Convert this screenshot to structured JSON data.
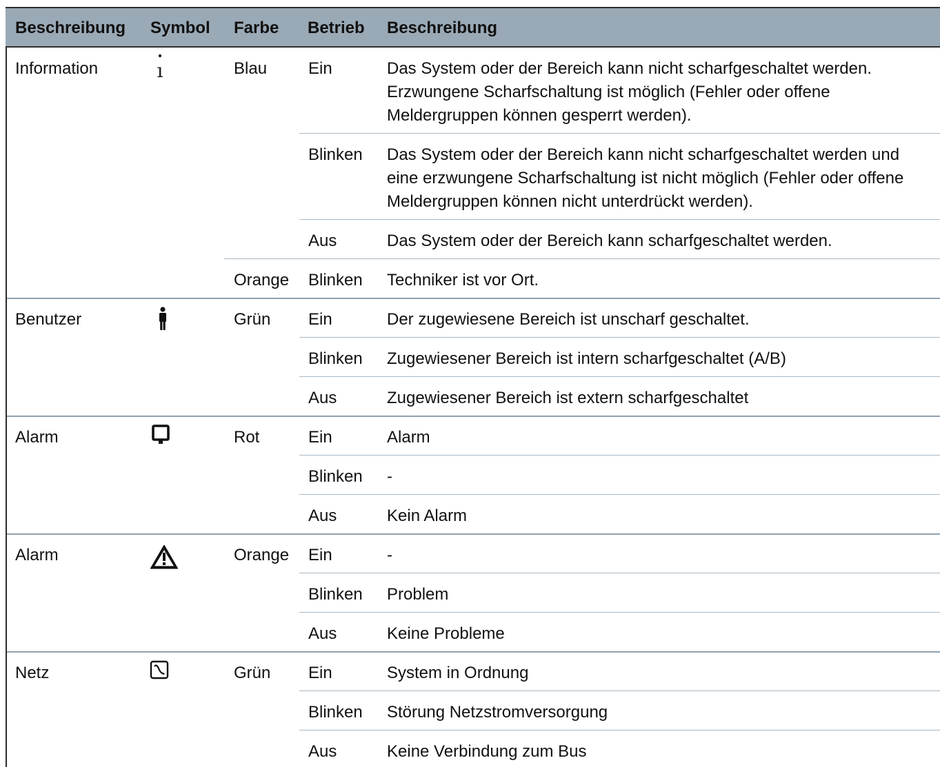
{
  "header": {
    "col1": "Beschreibung",
    "col2": "Symbol",
    "col3": "Farbe",
    "col4": "Betrieb",
    "col5": "Beschreibung"
  },
  "groups": [
    {
      "description": "Information",
      "icon": "info-i-icon",
      "rows": [
        {
          "color": "Blau",
          "operation": "Ein",
          "text": "Das System oder der Bereich kann nicht scharfgeschaltet werden. Erzwungene Scharfschaltung ist möglich (Fehler oder offene Meldergruppen können gesperrt werden)."
        },
        {
          "color": "",
          "operation": "Blinken",
          "text": "Das System oder der Bereich kann nicht scharfgeschaltet werden und eine erzwungene Scharfschaltung ist nicht möglich (Fehler oder offene Meldergruppen können nicht unterdrückt werden)."
        },
        {
          "color": "",
          "operation": "Aus",
          "text": "Das System oder der Bereich kann scharfgeschaltet werden."
        },
        {
          "color": "Orange",
          "operation": "Blinken",
          "text": "Techniker ist vor Ort."
        }
      ]
    },
    {
      "description": "Benutzer",
      "icon": "person-icon",
      "rows": [
        {
          "color": "Grün",
          "operation": "Ein",
          "text": "Der zugewiesene Bereich ist unscharf geschaltet."
        },
        {
          "color": "",
          "operation": "Blinken",
          "text": "Zugewiesener Bereich ist intern scharfgeschaltet (A/B)"
        },
        {
          "color": "",
          "operation": "Aus",
          "text": "Zugewiesener Bereich ist extern scharfgeschaltet"
        }
      ]
    },
    {
      "description": "Alarm",
      "icon": "bell-icon",
      "rows": [
        {
          "color": "Rot",
          "operation": "Ein",
          "text": "Alarm"
        },
        {
          "color": "",
          "operation": "Blinken",
          "text": "-"
        },
        {
          "color": "",
          "operation": "Aus",
          "text": "Kein Alarm"
        }
      ]
    },
    {
      "description": "Alarm",
      "icon": "warning-triangle-icon",
      "rows": [
        {
          "color": "Orange",
          "operation": "Ein",
          "text": "-"
        },
        {
          "color": "",
          "operation": "Blinken",
          "text": "Problem"
        },
        {
          "color": "",
          "operation": "Aus",
          "text": "Keine Probleme"
        }
      ]
    },
    {
      "description": "Netz",
      "icon": "ac-power-icon",
      "rows": [
        {
          "color": "Grün",
          "operation": "Ein",
          "text": "System in Ordnung"
        },
        {
          "color": "",
          "operation": "Blinken",
          "text": "Störung Netzstromversorgung"
        },
        {
          "color": "",
          "operation": "Aus",
          "text": "Keine Verbindung zum Bus"
        }
      ]
    }
  ],
  "colors": {
    "header_bg": "#9aa9b6",
    "rule": "#a9b8c4",
    "border": "#2c2c2c"
  }
}
